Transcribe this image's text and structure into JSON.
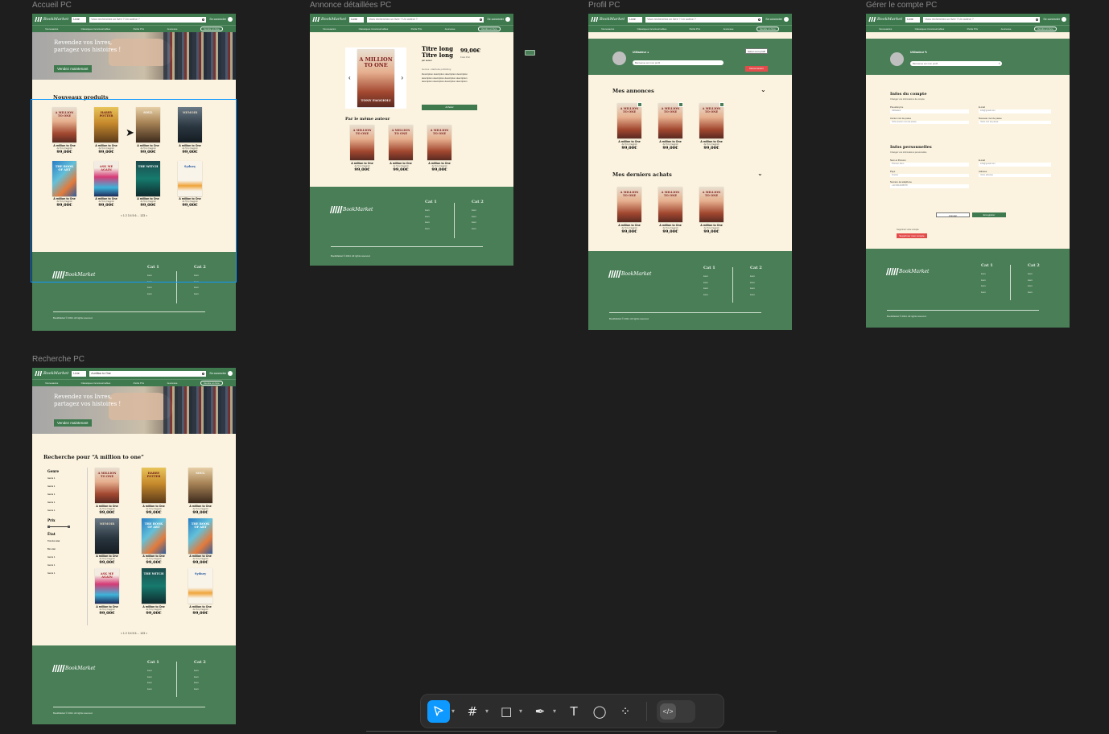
{
  "frames": {
    "home": "Accueil PC",
    "detail": "Annonce détaillées PC",
    "profile": "Profil PC",
    "account": "Gérer le compte PC",
    "search": "Recherche PC"
  },
  "brand": {
    "logo": "BookMarket"
  },
  "header": {
    "category_select": "Livre",
    "search_placeholder": "Vous recherchez un livre ? Un auteur ?",
    "search_value": "A million to One",
    "login": "Se connecter"
  },
  "subnav": [
    "Nouveautés",
    "Classiques incontournables",
    "Petits Prix",
    "Jeunesse",
    "Vendre un livre"
  ],
  "hero": {
    "headline": "Revendez vos livres, partagez vos histoires !",
    "cta": "Vendez maintenant"
  },
  "home": {
    "section_title": "Nouveaux produits",
    "products": [
      {
        "cover": "c-million",
        "cover_text": "A MILLION TO ONE",
        "name": "A million to One",
        "author": "de Tony Faggioli",
        "price": "99,00€"
      },
      {
        "cover": "c-harry",
        "cover_text": "HARRY POTTER",
        "name": "A million to One",
        "author": "de Tony Faggioli",
        "price": "99,00€"
      },
      {
        "cover": "c-soul",
        "cover_text": "SOUL",
        "name": "A million to One",
        "author": "de Tony Faggioli",
        "price": "99,00€"
      },
      {
        "cover": "c-memoir",
        "cover_text": "MEMOIR",
        "name": "A million to One",
        "author": "de Tony Faggioli",
        "price": "99,00€"
      },
      {
        "cover": "c-art",
        "cover_text": "THE BOOK OF ART",
        "name": "A million to One",
        "author": "de Tony Faggioli",
        "price": "99,00€"
      },
      {
        "cover": "c-ask",
        "cover_text": "ASK ME AGAIN",
        "name": "A million to One",
        "author": "de Tony Faggioli",
        "price": "99,00€"
      },
      {
        "cover": "c-witch",
        "cover_text": "THE WITCH",
        "name": "A million to One",
        "author": "de Tony Faggioli",
        "price": "99,00€"
      },
      {
        "cover": "c-sydney",
        "cover_text": "Sydney",
        "name": "A million to One",
        "author": "de Tony Faggioli",
        "price": "99,00€"
      }
    ],
    "pager": "< 1 2 3 4 5 6 ... 123 >"
  },
  "footer": {
    "cat1": "Cat 1",
    "cat2": "Cat 2",
    "links": [
      "Lien",
      "Lien",
      "Lien",
      "Lien"
    ],
    "copyright": "BookMarket © 2024. All rights reserved."
  },
  "detail": {
    "title_line1": "Titre long",
    "title_line2": "Titre long",
    "author": "par auteur",
    "price": "99,00€",
    "price_sub": "Frais Port",
    "meta": "Genres • Hachette publishing",
    "desc": "Description description description description description description description description description description description description",
    "buy": "Acheter",
    "cover_text": "A MILLION TO ONE",
    "cover_author": "TONY FAGGIOLI",
    "same_author": "Par le même auteur"
  },
  "profile": {
    "username": "Utilisateur",
    "bio_placeholder": "Bienvenue sur mon profil",
    "edit": "Gérer mon profil",
    "logout": "Déconnexion",
    "my_listings": "Mes annonces",
    "my_purchases": "Mes derniers achats"
  },
  "account": {
    "username": "Utilisateur",
    "bio": "Bienvenue sur mon profil",
    "section1": "Infos du compte",
    "section1_sub": "Changez vos informations de compte",
    "section2": "Infos personnelles",
    "section2_sub": "Changez vos informations personnelles",
    "fields1": [
      {
        "label": "Pseudonyme",
        "value": "Utilisateur"
      },
      {
        "label": "E-mail",
        "value": "info@gmail.com"
      },
      {
        "label": "Ancien mot de passe",
        "value": "Votre ancien mot de passe"
      },
      {
        "label": "Nouveau mot de passe",
        "value": "Votre mot de passe"
      }
    ],
    "fields2": [
      {
        "label": "Nom et Prénom",
        "value": "Prénom Nom"
      },
      {
        "label": "E-mail",
        "value": "info@gmail.com"
      },
      {
        "label": "Pays",
        "value": "France"
      },
      {
        "label": "Adresse",
        "value": "Votre adresse"
      },
      {
        "label": "Numéro de téléphone",
        "value": "+33 0612345678"
      }
    ],
    "cancel": "Annuler",
    "save": "Enregistrer",
    "delete_hint": "Supprimer votre compte",
    "delete": "Supprimer mon compte"
  },
  "search": {
    "title": "Recherche pour “A million to one”",
    "filters": {
      "genre": "Genre",
      "genre_items": [
        "Genre 1",
        "Genre 1",
        "Genre 1",
        "Genre 1",
        "Genre 1"
      ],
      "price": "Prix",
      "state": "État",
      "state_items": [
        "Très bon état",
        "Bon état",
        "Genre 1",
        "Genre 1",
        "Genre 1"
      ]
    },
    "products": [
      {
        "cover": "c-million",
        "cover_text": "A MILLION TO ONE"
      },
      {
        "cover": "c-harry",
        "cover_text": "HARRY POTTER"
      },
      {
        "cover": "c-soul",
        "cover_text": "SOUL"
      },
      {
        "cover": "c-memoir",
        "cover_text": "MEMOIR"
      },
      {
        "cover": "c-art",
        "cover_text": "THE BOOK OF ART"
      },
      {
        "cover": "c-art",
        "cover_text": "THE BOOK OF ART"
      },
      {
        "cover": "c-ask",
        "cover_text": "ASK ME AGAIN"
      },
      {
        "cover": "c-witch",
        "cover_text": "THE WITCH"
      },
      {
        "cover": "c-sydney",
        "cover_text": "Sydney"
      }
    ],
    "product_name": "A million to One",
    "product_author": "de Tony Faggioli",
    "product_price": "99,00€",
    "pager": "< 1 2 3 4 5 6 ... 123 >"
  },
  "toolbar": {
    "tools": [
      "move-tool",
      "frame-tool",
      "shape-tool",
      "pen-tool",
      "text-tool",
      "comment-tool",
      "actions-tool",
      "dev-mode-toggle"
    ]
  },
  "colors": {
    "brand_green": "#3f7a4f",
    "page_bg": "#fbf3df",
    "canvas_bg": "#1e1e1e",
    "selection": "#0d99ff",
    "danger": "#e44c4c"
  }
}
